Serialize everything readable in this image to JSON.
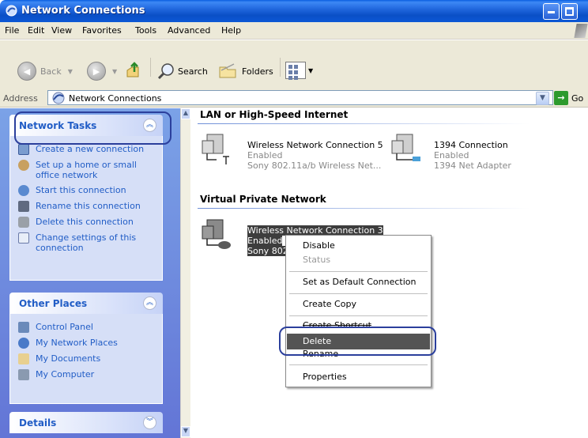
{
  "window": {
    "title": "Network Connections"
  },
  "menu": [
    "File",
    "Edit",
    "View",
    "Favorites",
    "Tools",
    "Advanced",
    "Help"
  ],
  "toolbar": {
    "back": "Back",
    "search": "Search",
    "folders": "Folders"
  },
  "address": {
    "label": "Address",
    "value": "Network Connections",
    "go": "Go"
  },
  "tasks_pane": {
    "network_tasks": {
      "title": "Network Tasks",
      "items": [
        "Create a new connection",
        "Set up a home or small office network",
        "Start this connection",
        "Rename this connection",
        "Delete this connection",
        "Change settings of this connection"
      ]
    },
    "other_places": {
      "title": "Other Places",
      "items": [
        "Control Panel",
        "My Network Places",
        "My Documents",
        "My Computer"
      ]
    },
    "details": {
      "title": "Details"
    }
  },
  "main": {
    "lan_group": {
      "title": "LAN or High-Speed Internet",
      "connections": [
        {
          "name": "Wireless Network Connection 5",
          "status": "Enabled",
          "device": "Sony 802.11a/b Wireless Net..."
        },
        {
          "name": "1394 Connection",
          "status": "Enabled",
          "device": "1394 Net Adapter"
        }
      ]
    },
    "vpn_group": {
      "title": "Virtual Private Network",
      "connection": {
        "name": "Wireless Network Connection 3",
        "status": "Enabled",
        "device": "Sony 802"
      }
    }
  },
  "context_menu": {
    "disable": "Disable",
    "status": "Status",
    "set_default": "Set as Default Connection",
    "create_copy": "Create Copy",
    "create_shortcut": "Create Shortcut",
    "delete": "Delete",
    "rename": "Rename",
    "properties": "Properties"
  },
  "colors": {
    "highlight_outline": "#2b3f9c",
    "task_link": "#215dc6",
    "title_bar": "#0a4fc6"
  }
}
